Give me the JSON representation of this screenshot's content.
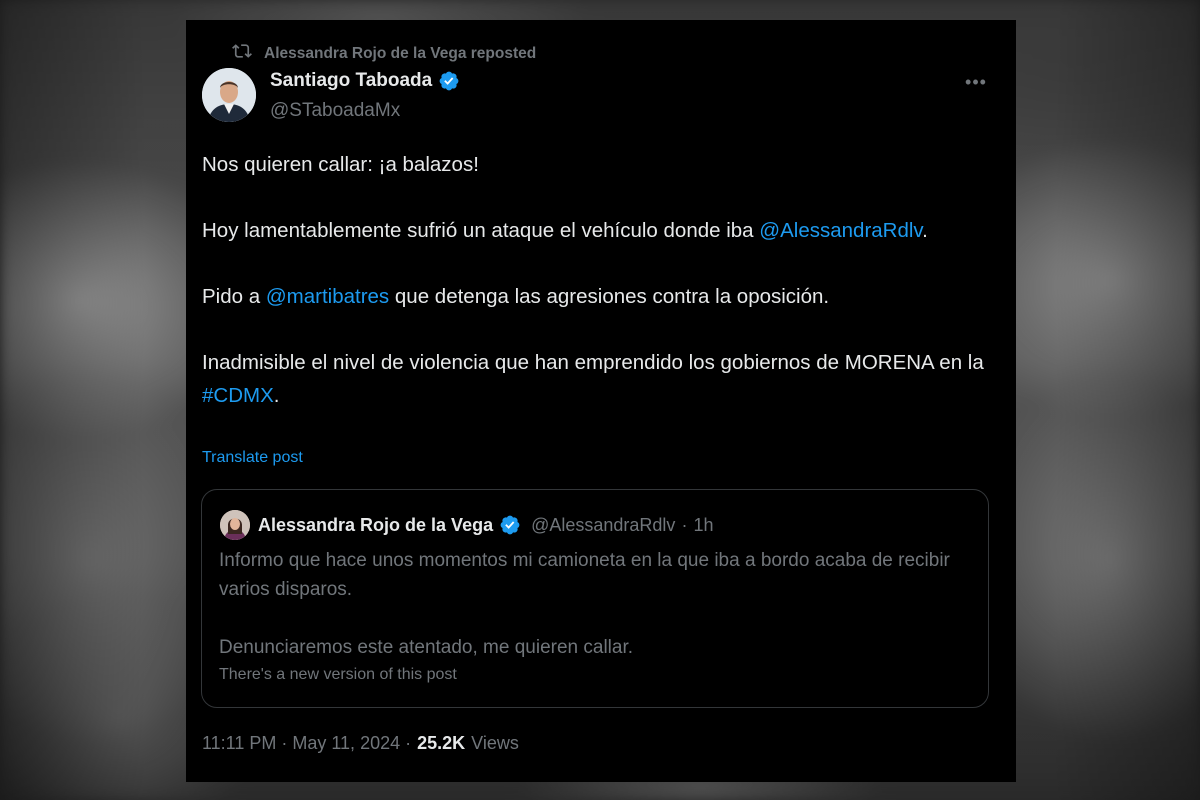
{
  "repost": {
    "icon": "repost-icon",
    "text": "Alessandra Rojo de la Vega reposted"
  },
  "author": {
    "name": "Santiago Taboada",
    "handle": "@STaboadaMx",
    "verified": true,
    "avatar": "avatar"
  },
  "more_icon": "ellipsis-icon",
  "post": {
    "line1": "Nos quieren callar: ¡a balazos!",
    "p2_text": "Hoy lamentablemente sufrió un ataque el vehículo donde iba",
    "p2_mention": "@AlessandraRdlv",
    "p2_end": ".",
    "p3_start": "Pido a",
    "p3_mention": "@martibatres",
    "p3_end": "que detenga las agresiones contra la oposición.",
    "p4_text": "Inadmisible el nivel de violencia que han emprendido los gobiernos de MORENA en la",
    "p4_hashtag": "#CDMX",
    "p4_end": "."
  },
  "translate_label": "Translate post",
  "quote": {
    "name": "Alessandra Rojo de la Vega",
    "handle": "@AlessandraRdlv",
    "separator": "·",
    "time": "1h",
    "text1": "Informo que hace unos momentos mi camioneta en la que iba a bordo acaba de recibir varios disparos.",
    "text2": "Denunciaremos este atentado, me quieren callar.",
    "note": "There's a new version of this post"
  },
  "footer": {
    "timestamp": "11:11 PM · May 11, 2024 ·",
    "views_count": "25.2K",
    "views_label": "Views"
  },
  "colors": {
    "link": "#1d9bf0",
    "muted": "#71767b",
    "text": "#e7e9ea",
    "background": "#000000"
  }
}
